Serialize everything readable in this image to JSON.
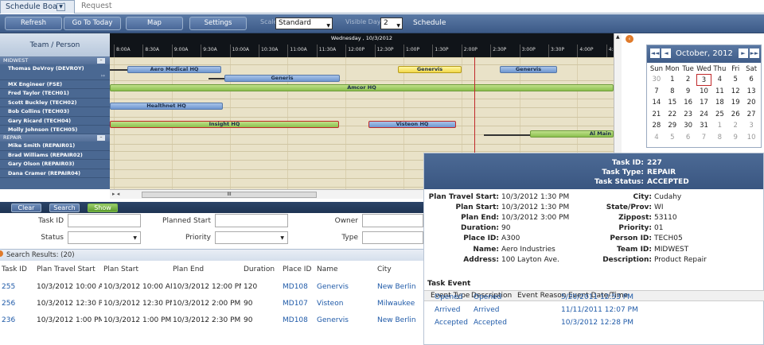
{
  "tabs": {
    "active": "Schedule Board",
    "inactive": "Request"
  },
  "toolbar": {
    "refresh": "Refresh",
    "goto_today": "Go To Today",
    "map": "Map",
    "settings": "Settings",
    "scale_label": "Scale",
    "scale_value": "Standard",
    "visible_days_label": "Visible Days",
    "visible_days_value": "2",
    "title": "Schedule"
  },
  "board": {
    "column_header": "Team / Person",
    "date_header": "Wednesday , 10/3/2012",
    "times": [
      "8:00A",
      "8:30A",
      "9:00A",
      "9:30A",
      "10:00A",
      "10:30A",
      "11:00A",
      "11:30A",
      "12:00P",
      "12:30P",
      "1:00P",
      "1:30P",
      "2:00P",
      "2:30P",
      "3:00P",
      "3:30P",
      "4:00P",
      "4:"
    ],
    "groups": [
      {
        "name": "MIDWEST",
        "people": [
          "Thomas DeVroy (DEVROY)",
          "MX Engineer (FSE)",
          "Fred Taylor (TECH01)",
          "Scott Buckley (TECH02)",
          "Bob Collins (TECH03)",
          "Gary Ricard (TECH04)",
          "Molly Johnson (TECH05)"
        ]
      },
      {
        "name": "REPAIR",
        "people": [
          "Mike Smith (REPAIR01)",
          "Brad Williams (REPAIR02)",
          "Gary Olson (REPAIR03)",
          "Dana Cramer (REPAIR04)"
        ]
      }
    ],
    "events": [
      "Aero Medical HQ",
      "Generis",
      "Genervis",
      "Genervis",
      "Amcor HQ",
      "Healthnet HQ",
      "Insight HQ",
      "Visteon HQ",
      "Al Main"
    ],
    "scroll_thumb": "III"
  },
  "calendar": {
    "prev": "◄",
    "next": "►",
    "prev_year": "◄◄",
    "next_year": "►►",
    "title": "October, 2012",
    "dow": [
      "Sun",
      "Mon",
      "Tue",
      "Wed",
      "Thu",
      "Fri",
      "Sat"
    ],
    "weeks": [
      [
        "30",
        "1",
        "2",
        "3",
        "4",
        "5",
        "6"
      ],
      [
        "7",
        "8",
        "9",
        "10",
        "11",
        "12",
        "13"
      ],
      [
        "14",
        "15",
        "16",
        "17",
        "18",
        "19",
        "20"
      ],
      [
        "21",
        "22",
        "23",
        "24",
        "25",
        "26",
        "27"
      ],
      [
        "28",
        "29",
        "30",
        "31",
        "1",
        "2",
        "3"
      ],
      [
        "4",
        "5",
        "6",
        "7",
        "8",
        "9",
        "10"
      ]
    ],
    "selected": "3"
  },
  "filter": {
    "clear": "Clear",
    "search": "Search",
    "show": "Show",
    "task_id_label": "Task ID",
    "planned_start_label": "Planned Start",
    "owner_label": "Owner",
    "status_label": "Status",
    "priority_label": "Priority",
    "type_label": "Type"
  },
  "results": {
    "header": "Search Results: (20)",
    "columns": [
      "Task ID",
      "Plan Travel Start",
      "Plan Start",
      "Plan End",
      "Duration",
      "Place ID",
      "Name",
      "City"
    ],
    "rows": [
      [
        "255",
        "10/3/2012 10:00 AM",
        "10/3/2012 10:00 AM",
        "10/3/2012 12:00 PM",
        "120",
        "MD108",
        "Genervis",
        "New Berlin"
      ],
      [
        "256",
        "10/3/2012 12:30 PM",
        "10/3/2012 12:30 PM",
        "10/3/2012 2:00 PM",
        "90",
        "MD107",
        "Visteon",
        "Milwaukee"
      ],
      [
        "236",
        "10/3/2012 1:00 PM",
        "10/3/2012 1:00 PM",
        "10/3/2012 2:30 PM",
        "90",
        "MD108",
        "Genervis",
        "New Berlin"
      ]
    ]
  },
  "detail": {
    "task_id_label": "Task ID:",
    "task_id": "227",
    "task_type_label": "Task Type:",
    "task_type": "REPAIR",
    "task_status_label": "Task Status:",
    "task_status": "ACCEPTED",
    "left": [
      {
        "label": "Plan Travel Start:",
        "value": "10/3/2012 1:30 PM"
      },
      {
        "label": "Plan Start:",
        "value": "10/3/2012 1:30 PM"
      },
      {
        "label": "Plan End:",
        "value": "10/3/2012 3:00 PM"
      },
      {
        "label": "Duration:",
        "value": "90"
      },
      {
        "label": "Place ID:",
        "value": "A300"
      },
      {
        "label": "Name:",
        "value": "Aero Industries"
      },
      {
        "label": "Address:",
        "value": "100 Layton Ave."
      }
    ],
    "right": [
      {
        "label": "City:",
        "value": "Cudahy"
      },
      {
        "label": "State/Prov:",
        "value": "WI"
      },
      {
        "label": "Zippost:",
        "value": "53110"
      },
      {
        "label": "Priority:",
        "value": "01"
      },
      {
        "label": "Person ID:",
        "value": "TECH05"
      },
      {
        "label": "Team ID:",
        "value": "MIDWEST"
      },
      {
        "label": "Description:",
        "value": "Product Repair"
      }
    ],
    "event_title": "Task Event",
    "event_columns": [
      "Event Type",
      "Description",
      "Event Reason",
      "Event Date/Time"
    ],
    "events": [
      [
        "Opened",
        "Opened",
        "",
        "5/20/2011 12:53 PM"
      ],
      [
        "Arrived",
        "Arrived",
        "",
        "11/11/2011 12:07 PM"
      ],
      [
        "Accepted",
        "Accepted",
        "",
        "10/3/2012 12:28 PM"
      ]
    ]
  }
}
